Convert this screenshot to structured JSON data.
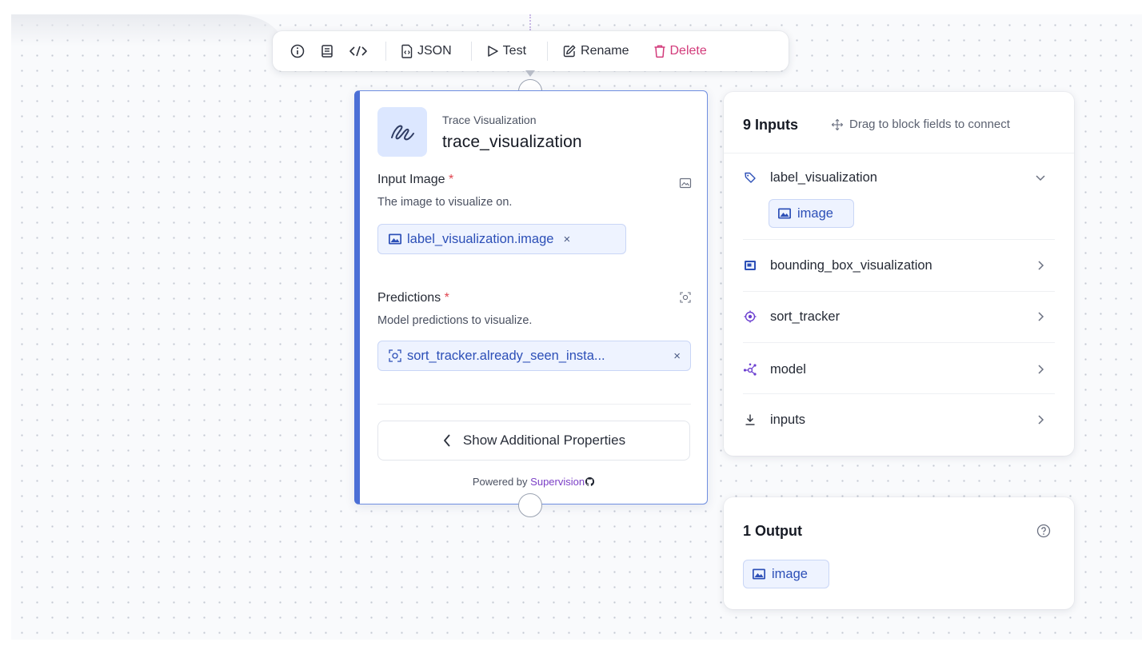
{
  "toolbar": {
    "icons": [
      "info-icon",
      "docs-icon",
      "code-icon"
    ],
    "json_label": "JSON",
    "test_label": "Test",
    "rename_label": "Rename",
    "delete_label": "Delete",
    "delete_color": "#d23a7a"
  },
  "block": {
    "type_label": "Trace Visualization",
    "name": "trace_visualization",
    "accent_color": "#4b6fd6",
    "fields": [
      {
        "label": "Input Image",
        "required_mark": "*",
        "description": "The image to visualize on.",
        "value": "label_visualization.image",
        "remove": "×"
      },
      {
        "label": "Predictions",
        "required_mark": "*",
        "description": "Model predictions to visualize.",
        "value": "sort_tracker.already_seen_insta...",
        "remove": "×"
      }
    ],
    "show_more_label": "Show Additional Properties",
    "powered_by": "Powered by",
    "powered_brand": "Supervision"
  },
  "inputs_panel": {
    "title": "9 Inputs",
    "hint": "Drag to block fields to connect",
    "items": [
      {
        "name": "label_visualization",
        "icon": "tag-icon",
        "expanded": true,
        "sub_chip": "image"
      },
      {
        "name": "bounding_box_visualization",
        "icon": "bbox-image-icon",
        "expanded": false
      },
      {
        "name": "sort_tracker",
        "icon": "target-icon",
        "expanded": false
      },
      {
        "name": "model",
        "icon": "model-graph-icon",
        "expanded": false
      },
      {
        "name": "inputs",
        "icon": "download-icon",
        "expanded": false
      }
    ]
  },
  "output_panel": {
    "title": "1 Output",
    "chip": "image"
  }
}
